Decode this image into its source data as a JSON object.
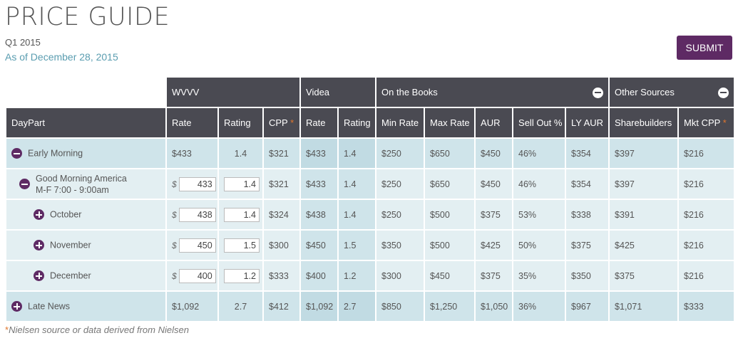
{
  "header": {
    "title": "PRICE GUIDE",
    "quarter": "Q1 2015",
    "as_of": "As of December 28, 2015",
    "submit_label": "SUBMIT"
  },
  "groups": {
    "wvvv": "WVVV",
    "videa": "Videa",
    "on_books": "On the Books",
    "other": "Other Sources"
  },
  "columns": {
    "daypart": "DayPart",
    "rate": "Rate",
    "rating": "Rating",
    "cpp": "CPP",
    "v_rate": "Rate",
    "v_rating": "Rating",
    "min_rate": "Min Rate",
    "max_rate": "Max Rate",
    "aur": "AUR",
    "sell_out": "Sell Out %",
    "ly_aur": "LY AUR",
    "sharebuilders": "Sharebuilders",
    "mkt_cpp": "Mkt CPP",
    "star": "*"
  },
  "rows": [
    {
      "name": "Early Morning",
      "rate": "$433",
      "rating": "1.4",
      "cpp": "$321",
      "v_rate": "$433",
      "v_rating": "1.4",
      "min_rate": "$250",
      "max_rate": "$650",
      "aur": "$450",
      "sell_out": "46%",
      "ly_aur": "$354",
      "sharebuilders": "$397",
      "mkt_cpp": "$216"
    },
    {
      "name": "Good Morning America",
      "time": "M-F 7:00 - 9:00am",
      "dollar": "$",
      "rate_input": "433",
      "rating_input": "1.4",
      "cpp": "$321",
      "v_rate": "$433",
      "v_rating": "1.4",
      "min_rate": "$250",
      "max_rate": "$650",
      "aur": "$450",
      "sell_out": "46%",
      "ly_aur": "$354",
      "sharebuilders": "$397",
      "mkt_cpp": "$216"
    },
    {
      "name": "October",
      "dollar": "$",
      "rate_input": "438",
      "rating_input": "1.4",
      "cpp": "$324",
      "v_rate": "$438",
      "v_rating": "1.4",
      "min_rate": "$250",
      "max_rate": "$500",
      "aur": "$375",
      "sell_out": "53%",
      "ly_aur": "$338",
      "sharebuilders": "$391",
      "mkt_cpp": "$216"
    },
    {
      "name": "November",
      "dollar": "$",
      "rate_input": "450",
      "rating_input": "1.5",
      "cpp": "$300",
      "v_rate": "$450",
      "v_rating": "1.5",
      "min_rate": "$350",
      "max_rate": "$500",
      "aur": "$425",
      "sell_out": "50%",
      "ly_aur": "$375",
      "sharebuilders": "$425",
      "mkt_cpp": "$216"
    },
    {
      "name": "December",
      "dollar": "$",
      "rate_input": "400",
      "rating_input": "1.2",
      "cpp": "$333",
      "v_rate": "$400",
      "v_rating": "1.2",
      "min_rate": "$300",
      "max_rate": "$450",
      "aur": "$375",
      "sell_out": "35%",
      "ly_aur": "$350",
      "sharebuilders": "$375",
      "mkt_cpp": "$216"
    },
    {
      "name": "Late News",
      "rate": "$1,092",
      "rating": "2.7",
      "cpp": "$412",
      "v_rate": "$1,092",
      "v_rating": "2.7",
      "min_rate": "$850",
      "max_rate": "$1,250",
      "aur": "$1,050",
      "sell_out": "36%",
      "ly_aur": "$967",
      "sharebuilders": "$1,071",
      "mkt_cpp": "$333"
    }
  ],
  "footnote": {
    "star": "*",
    "text": "Nielsen source or data derived from Nielsen"
  },
  "colors": {
    "header_bg": "#4a4a52",
    "accent_purple": "#5e2a64",
    "row_bg": "#cfe4ea",
    "subrow_bg": "#e3eff2",
    "star_orange": "#e0762d",
    "date_teal": "#5a9db0"
  }
}
